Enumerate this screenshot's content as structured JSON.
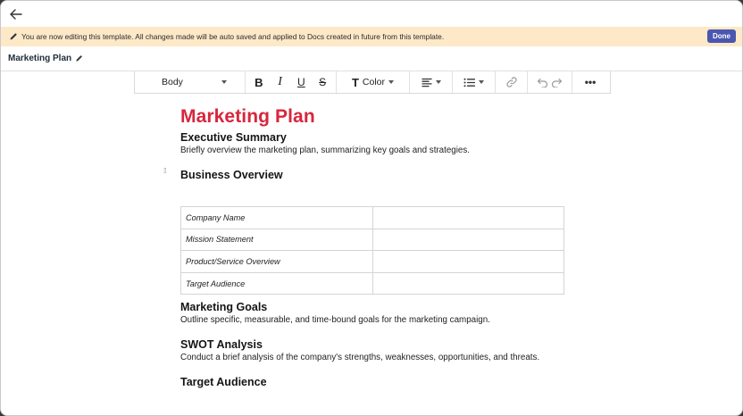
{
  "banner": {
    "message": "You are now editing this template. All changes made will be auto saved and applied to Docs created in future from this template.",
    "done_label": "Done"
  },
  "doc_header": {
    "name": "Marketing Plan"
  },
  "toolbar": {
    "style_value": "Body",
    "bold": "B",
    "italic": "I",
    "underline": "U",
    "strike": "S",
    "color_glyph": "T",
    "color_label": "Color",
    "more": "•••"
  },
  "document": {
    "title": "Marketing Plan",
    "sections": [
      {
        "heading": "Executive Summary",
        "text": "Briefly overview the marketing plan, summarizing key goals and strategies."
      },
      {
        "heading": "Business Overview"
      },
      {
        "heading": "Marketing Goals",
        "text": "Outline specific, measurable, and time-bound goals for the marketing campaign."
      },
      {
        "heading": "SWOT Analysis",
        "text": "Conduct a brief analysis of the company's strengths, weaknesses, opportunities, and threats."
      },
      {
        "heading": "Target Audience"
      }
    ],
    "business_table": [
      {
        "label": "Company Name",
        "value": ""
      },
      {
        "label": "Mission Statement",
        "value": ""
      },
      {
        "label": "Product/Service Overview",
        "value": ""
      },
      {
        "label": "Target Audience",
        "value": ""
      }
    ]
  },
  "colors": {
    "banner_bg": "#fde9c8",
    "done_bg": "#4a56b0",
    "title_red": "#d7263d"
  }
}
